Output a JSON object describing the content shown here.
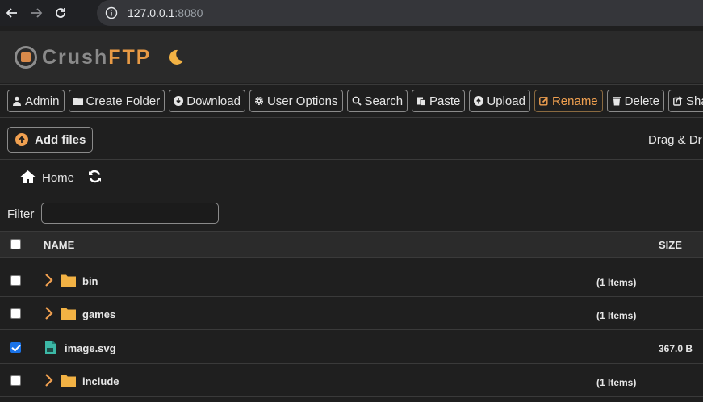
{
  "browser": {
    "url_host": "127.0.0.1",
    "url_port": ":8080"
  },
  "app": {
    "logo_part1": "Crush",
    "logo_part2": "FTP"
  },
  "toolbar": {
    "buttons": [
      {
        "label": "Admin",
        "icon": "user-icon"
      },
      {
        "label": "Create Folder",
        "icon": "folder-icon"
      },
      {
        "label": "Download",
        "icon": "download-icon"
      },
      {
        "label": "User Options",
        "icon": "gear-icon"
      },
      {
        "label": "Search",
        "icon": "search-icon"
      },
      {
        "label": "Paste",
        "icon": "paste-icon"
      },
      {
        "label": "Upload",
        "icon": "upload-icon"
      },
      {
        "label": "Rename",
        "icon": "edit-icon"
      },
      {
        "label": "Delete",
        "icon": "trash-icon"
      },
      {
        "label": "Share",
        "icon": "share-icon"
      }
    ]
  },
  "upload": {
    "add_files_label": "Add files",
    "drag_text": "Drag & Dr"
  },
  "breadcrumb": {
    "home_label": "Home"
  },
  "filter": {
    "label": "Filter",
    "value": ""
  },
  "table": {
    "headers": {
      "name": "NAME",
      "size": "SIZE"
    },
    "rows": [
      {
        "name": "bin",
        "type": "folder",
        "items": "(1 Items)",
        "size": "",
        "checked": false
      },
      {
        "name": "games",
        "type": "folder",
        "items": "(1 Items)",
        "size": "",
        "checked": false
      },
      {
        "name": "image.svg",
        "type": "file",
        "items": "",
        "size": "367.0 B",
        "checked": true
      },
      {
        "name": "include",
        "type": "folder",
        "items": "(1 Items)",
        "size": "",
        "checked": false
      }
    ]
  },
  "colors": {
    "accent": "#e89a45",
    "background": "#1f1f1f",
    "checkbox_checked": "#1a73e8"
  }
}
